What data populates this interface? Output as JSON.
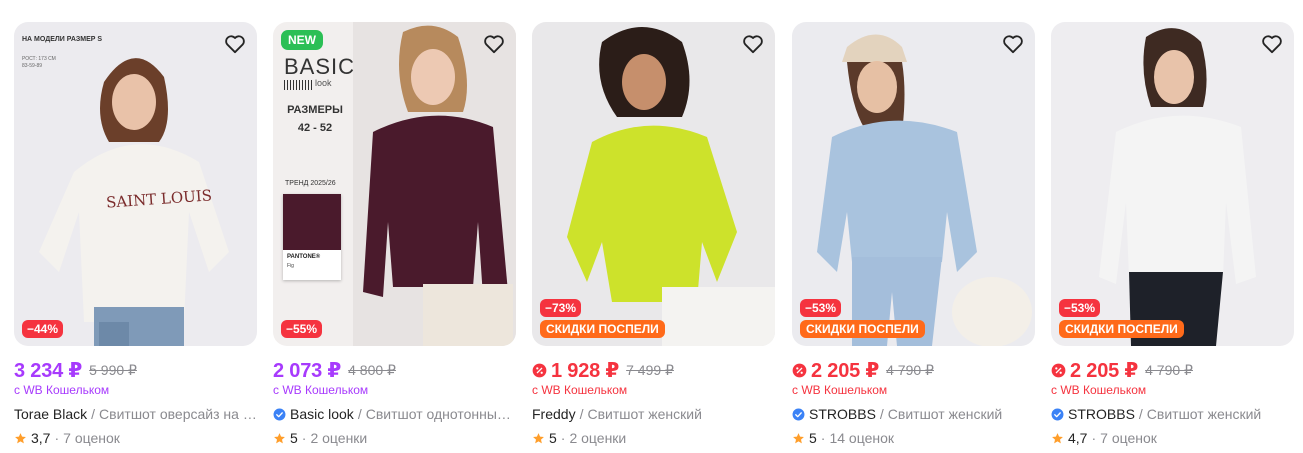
{
  "colors": {
    "wallet_purple": "#a73afd",
    "wallet_red": "#f5333f",
    "discount_bg": "#f5333f",
    "promo_bg": "#ff6a1a",
    "new_bg": "#2bbf55",
    "star": "#ff9e2b",
    "verified": "#3b82f6"
  },
  "products": [
    {
      "image_overlay": {
        "model_size": "НА МОДЕЛИ РАЗМЕР S",
        "model_sub_1": "РОСТ: 173 СМ",
        "model_sub_2": "83-59-89",
        "print_text": "SAINT LOUIS"
      },
      "discount": "−44%",
      "promo": null,
      "price": "3 234 ₽",
      "old_price": "5 990 ₽",
      "price_color": "purple",
      "wallet_icon": false,
      "wallet_text": "с WB Кошельком",
      "brand": "Torae Black",
      "verified": false,
      "name": "Свитшот оверсайз на молнии",
      "rating": "3,7",
      "reviews": "7 оценок",
      "favorite_icon": "heart-outline-icon"
    },
    {
      "image_overlay": {
        "new_label": "NEW",
        "logo": "BASIC",
        "logo_sub": "look",
        "sizes_label": "РАЗМЕРЫ",
        "sizes_value": "42 - 52",
        "trend": "ТРЕНД 2025/26",
        "pantone": "PANTONE®",
        "pantone_sub": "Fig"
      },
      "discount": "−55%",
      "promo": null,
      "price": "2 073 ₽",
      "old_price": "4 800 ₽",
      "price_color": "purple",
      "wallet_icon": false,
      "wallet_text": "с WB Кошельком",
      "brand": "Basic look",
      "verified": true,
      "name": "Свитшот однотонный базовый",
      "rating": "5",
      "reviews": "2 оценки",
      "favorite_icon": "heart-outline-icon"
    },
    {
      "image_overlay": {},
      "discount": "−73%",
      "promo": "СКИДКИ ПОСПЕЛИ",
      "price": "1 928 ₽",
      "old_price": "7 499 ₽",
      "price_color": "red",
      "wallet_icon": true,
      "wallet_text": "с WB Кошельком",
      "brand": "Freddy",
      "verified": false,
      "name": "Свитшот женский",
      "rating": "5",
      "reviews": "2 оценки",
      "favorite_icon": "heart-outline-icon"
    },
    {
      "image_overlay": {},
      "discount": "−53%",
      "promo": "СКИДКИ ПОСПЕЛИ",
      "price": "2 205 ₽",
      "old_price": "4 790 ₽",
      "price_color": "red",
      "wallet_icon": true,
      "wallet_text": "с WB Кошельком",
      "brand": "STROBBS",
      "verified": true,
      "name": "Свитшот женский",
      "rating": "5",
      "reviews": "14 оценок",
      "favorite_icon": "heart-outline-icon"
    },
    {
      "image_overlay": {},
      "discount": "−53%",
      "promo": "СКИДКИ ПОСПЕЛИ",
      "price": "2 205 ₽",
      "old_price": "4 790 ₽",
      "price_color": "red",
      "wallet_icon": true,
      "wallet_text": "с WB Кошельком",
      "brand": "STROBBS",
      "verified": true,
      "name": "Свитшот женский",
      "rating": "4,7",
      "reviews": "7 оценок",
      "favorite_icon": "heart-outline-icon"
    }
  ]
}
